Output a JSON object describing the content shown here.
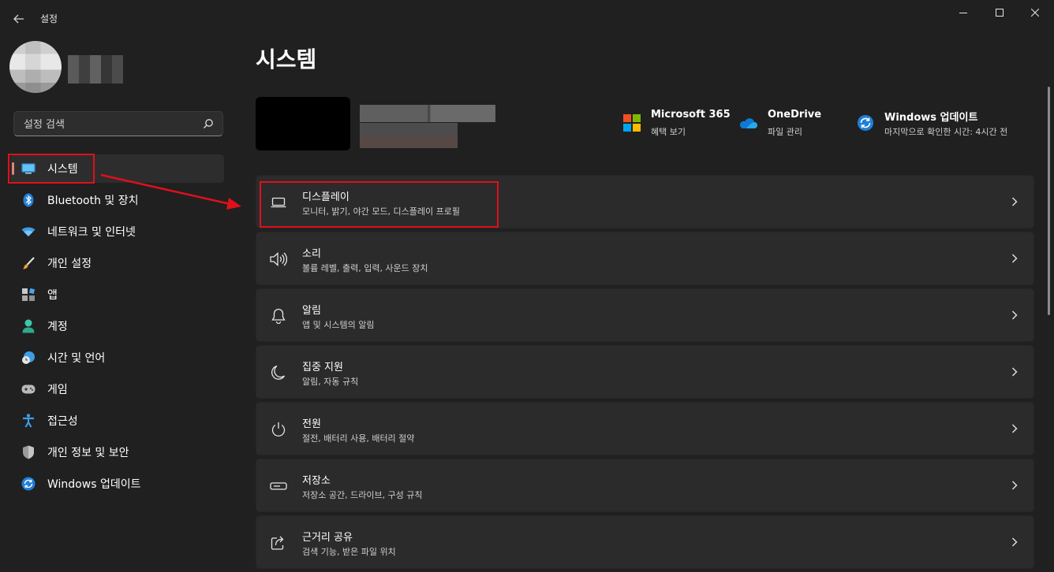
{
  "window": {
    "title": "설정"
  },
  "sidebar": {
    "search_placeholder": "설정 검색",
    "items": [
      {
        "label": "시스템",
        "icon": "monitor-icon",
        "active": true
      },
      {
        "label": "Bluetooth 및 장치",
        "icon": "bluetooth-icon"
      },
      {
        "label": "네트워크 및 인터넷",
        "icon": "wifi-icon"
      },
      {
        "label": "개인 설정",
        "icon": "brush-icon"
      },
      {
        "label": "앱",
        "icon": "apps-icon"
      },
      {
        "label": "계정",
        "icon": "account-icon"
      },
      {
        "label": "시간 및 언어",
        "icon": "globe-clock-icon"
      },
      {
        "label": "게임",
        "icon": "gamepad-icon"
      },
      {
        "label": "접근성",
        "icon": "accessibility-icon"
      },
      {
        "label": "개인 정보 및 보안",
        "icon": "shield-icon"
      },
      {
        "label": "Windows 업데이트",
        "icon": "update-icon"
      }
    ]
  },
  "main": {
    "title": "시스템",
    "quick_links": [
      {
        "title": "Microsoft 365",
        "subtitle": "혜택 보기",
        "icon": "microsoft-logo-icon"
      },
      {
        "title": "OneDrive",
        "subtitle": "파일 관리",
        "icon": "onedrive-cloud-icon"
      },
      {
        "title": "Windows 업데이트",
        "subtitle": "마지막으로 확인한 시간: 4시간 전",
        "icon": "update-icon"
      }
    ],
    "settings": [
      {
        "title": "디스플레이",
        "desc": "모니터, 밝기, 야간 모드, 디스플레이 프로필",
        "icon": "laptop-icon"
      },
      {
        "title": "소리",
        "desc": "볼륨 레벨, 출력, 입력, 사운드 장치",
        "icon": "speaker-icon"
      },
      {
        "title": "알림",
        "desc": "앱 및 시스템의 알림",
        "icon": "bell-icon"
      },
      {
        "title": "집중 지원",
        "desc": "알림, 자동 규칙",
        "icon": "moon-icon"
      },
      {
        "title": "전원",
        "desc": "절전, 배터리 사용, 배터리 절약",
        "icon": "power-icon"
      },
      {
        "title": "저장소",
        "desc": "저장소 공간, 드라이브, 구성 규칙",
        "icon": "storage-icon"
      },
      {
        "title": "근거리 공유",
        "desc": "검색 기능, 받은 파일 위치",
        "icon": "share-icon"
      }
    ]
  },
  "colors": {
    "background": "#202020",
    "card": "#2b2b2b",
    "accent_indicator": "#e0837a",
    "annotation_red": "#e0101a"
  }
}
